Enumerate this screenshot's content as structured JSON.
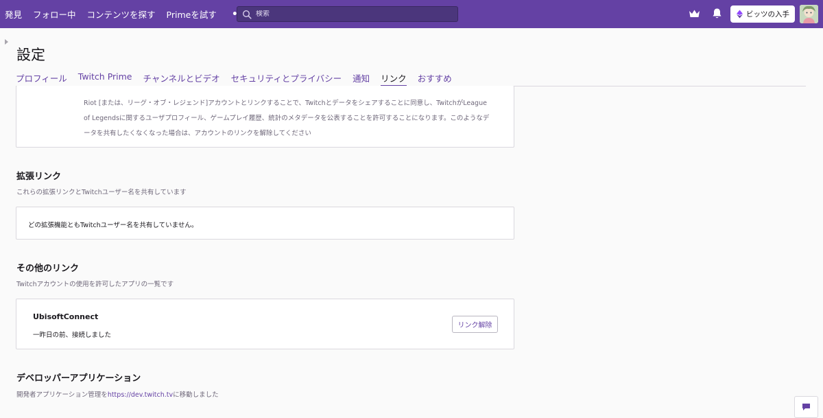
{
  "nav": {
    "links": [
      "発見",
      "フォロー中",
      "コンテンツを探す",
      "Primeを試す"
    ],
    "more": "•••",
    "search_placeholder": "検索",
    "bits_label": "ビッツの入手"
  },
  "page": {
    "title": "設定",
    "tabs": [
      "プロフィール",
      "Twitch Prime",
      "チャンネルとビデオ",
      "セキュリティとプライバシー",
      "通知",
      "リンク",
      "おすすめ"
    ],
    "active_tab": "リンク"
  },
  "riot": {
    "text": "Riot [または、リーグ・オブ・レジェンド]アカウントとリンクすることで、Twitchとデータをシェアすることに同意し、TwitchがLeague of Legendsに関するユーザプロフィール、ゲームプレイ履歴、統計のメタデータを公表することを許可することになります。このようなデータを共有したくなくなった場合は、アカウントのリンクを解除してください"
  },
  "extensions": {
    "title": "拡張リンク",
    "desc": "これらの拡張リンクとTwitchユーザー名を共有しています",
    "empty": "どの拡張機能ともTwitchユーザー名を共有していません。"
  },
  "other": {
    "title": "その他のリンク",
    "desc": "Twitchアカウントの使用を許可したアプリの一覧です",
    "app_name": "UbisoftConnect",
    "app_status": "一昨日の前、接続しました",
    "unlink": "リンク解除"
  },
  "developer": {
    "title": "デベロッパーアプリケーション",
    "desc_prefix": "開発者アプリケーション管理を",
    "link": "https://dev.twitch.tv",
    "desc_suffix": "に移動しました"
  },
  "colors": {
    "brand": "#6441a4",
    "background": "#fafafa",
    "card": "#ffffff",
    "muted_text": "#6e6779"
  }
}
